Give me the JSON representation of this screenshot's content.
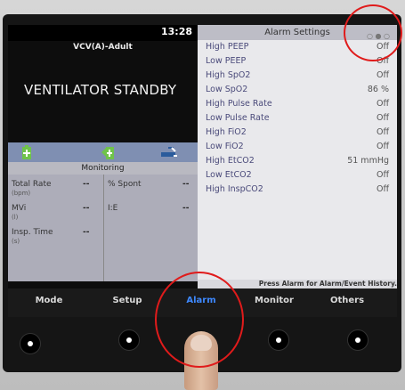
{
  "header": {
    "time": "13:28",
    "mode": "VCV(A)-Adult",
    "status": "VENTILATOR STANDBY"
  },
  "monitoring": {
    "title": "Monitoring",
    "params": [
      {
        "label": "Total Rate",
        "unit": "(bpm)",
        "value": "--"
      },
      {
        "label": "MVi",
        "unit": "(l)",
        "value": "--"
      },
      {
        "label": "Insp. Time",
        "unit": "(s)",
        "value": "--"
      }
    ],
    "params_right": [
      {
        "label": "% Spont",
        "value": "--"
      },
      {
        "label": "I:E",
        "value": "--"
      }
    ]
  },
  "alarm_settings": {
    "title": "Alarm Settings",
    "items": [
      {
        "label": "High PEEP",
        "value": "Off"
      },
      {
        "label": "Low PEEP",
        "value": "Off"
      },
      {
        "label": "High SpO2",
        "value": "Off"
      },
      {
        "label": "Low SpO2",
        "value": "86 %"
      },
      {
        "label": "High Pulse Rate",
        "value": "Off"
      },
      {
        "label": "Low Pulse Rate",
        "value": "Off"
      },
      {
        "label": "High FiO2",
        "value": "Off"
      },
      {
        "label": "Low FiO2",
        "value": "Off"
      },
      {
        "label": "High EtCO2",
        "value": "51 mmHg"
      },
      {
        "label": "Low EtCO2",
        "value": "Off"
      },
      {
        "label": "High InspCO2",
        "value": "Off"
      }
    ],
    "footer": "Press Alarm for Alarm/Event History."
  },
  "softkeys": [
    {
      "label": "Mode"
    },
    {
      "label": "Setup"
    },
    {
      "label": "Alarm"
    },
    {
      "label": "Monitor"
    },
    {
      "label": "Others"
    }
  ],
  "colors": {
    "active_softkey": "#3e89ff",
    "annotation": "#e01b1b"
  }
}
